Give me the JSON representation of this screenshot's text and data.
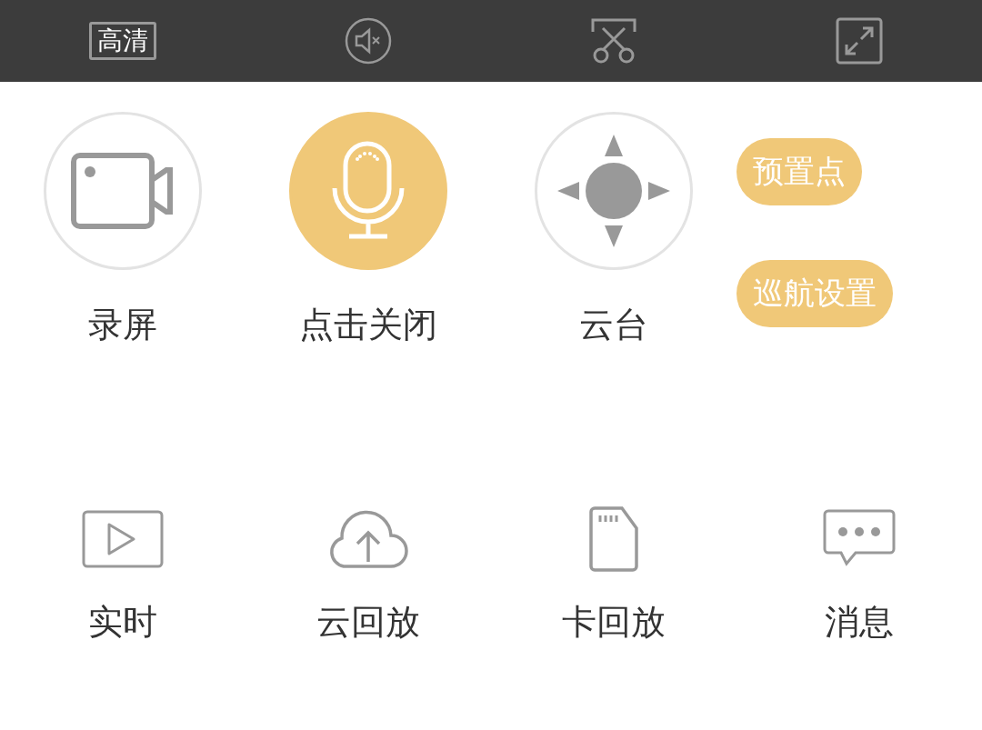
{
  "top_bar": {
    "quality": "高清",
    "buttons": [
      {
        "kind": "mute"
      },
      {
        "kind": "clip"
      },
      {
        "kind": "fullscreen"
      }
    ]
  },
  "controls": [
    {
      "kind": "record",
      "label": "录屏",
      "active": false
    },
    {
      "kind": "talk",
      "label": "点击关闭",
      "active": true
    },
    {
      "kind": "ptz",
      "label": "云台",
      "active": false
    }
  ],
  "ptz_options": [
    "预置点",
    "巡航设置"
  ],
  "shortcuts": [
    {
      "kind": "live",
      "label": "实时"
    },
    {
      "kind": "cloud",
      "label": "云回放"
    },
    {
      "kind": "card",
      "label": "卡回放"
    },
    {
      "kind": "message",
      "label": "消息"
    }
  ]
}
